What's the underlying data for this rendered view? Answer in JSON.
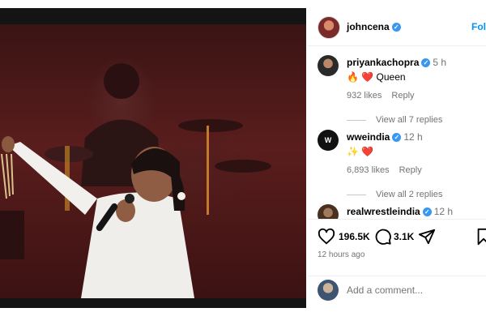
{
  "post": {
    "author": "johncena",
    "follow_label": "Follow",
    "time_ago": "12 hours ago"
  },
  "comments": [
    {
      "user": "priyankachopra",
      "time": "5 h",
      "text": "🔥 ❤️ Queen",
      "likes": "932 likes",
      "reply": "Reply",
      "view_replies": "View all 7 replies"
    },
    {
      "user": "wweindia",
      "time": "12 h",
      "text": "✨ ❤️",
      "likes": "6,893 likes",
      "reply": "Reply",
      "view_replies": "View all 2 replies"
    },
    {
      "user": "realwrestleindia",
      "time": "12 h"
    }
  ],
  "actions": {
    "likes_count": "196.5K",
    "comments_count": "3.1K"
  },
  "add_comment": {
    "placeholder": "Add a comment..."
  },
  "icons": {
    "verified": "verified-badge-icon",
    "like": "heart-icon",
    "comment": "comment-bubble-icon",
    "share": "paper-plane-icon",
    "save": "bookmark-icon"
  },
  "colors": {
    "accent": "#0095f6",
    "verified": "#3897f0",
    "muted": "#737373"
  }
}
